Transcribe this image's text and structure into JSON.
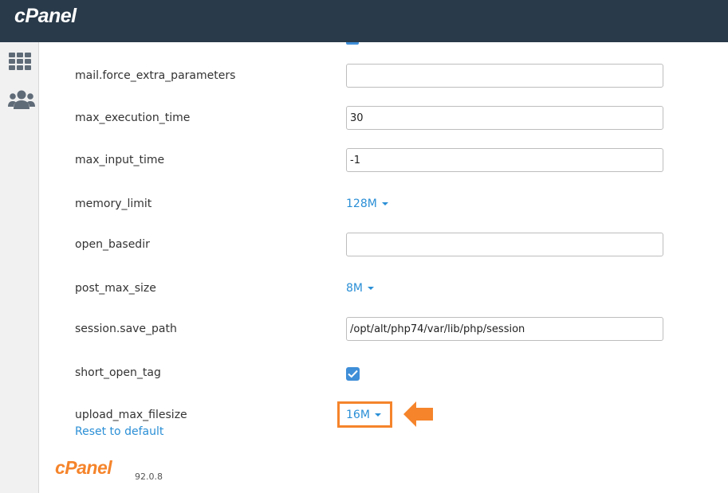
{
  "header": {
    "brand": "cPanel"
  },
  "sidebar": {
    "icons": [
      "grid-icon",
      "users-icon"
    ]
  },
  "settings": [
    {
      "name": "mail.force_extra_parameters",
      "type": "text",
      "value": ""
    },
    {
      "name": "max_execution_time",
      "type": "text",
      "value": "30"
    },
    {
      "name": "max_input_time",
      "type": "text",
      "value": "-1"
    },
    {
      "name": "memory_limit",
      "type": "select",
      "value": "128M"
    },
    {
      "name": "open_basedir",
      "type": "text",
      "value": ""
    },
    {
      "name": "post_max_size",
      "type": "select",
      "value": "8M"
    },
    {
      "name": "session.save_path",
      "type": "text",
      "value": "/opt/alt/php74/var/lib/php/session"
    },
    {
      "name": "short_open_tag",
      "type": "checkbox",
      "checked": true
    },
    {
      "name": "upload_max_filesize",
      "type": "select",
      "value": "16M"
    }
  ],
  "reset_link": "Reset to default",
  "footer": {
    "brand": "cPanel",
    "version": "92.0.8"
  },
  "colors": {
    "topbar": "#293a4a",
    "link": "#2a8fd6",
    "highlight": "#f5842b",
    "checkbox": "#3f8ed8"
  }
}
